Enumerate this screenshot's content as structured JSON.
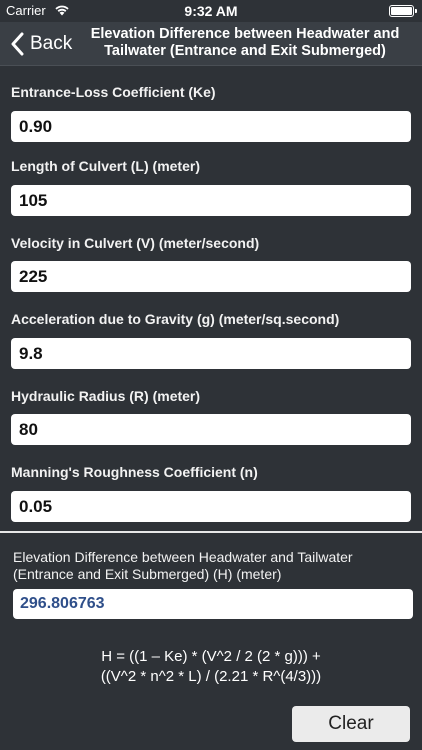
{
  "status_bar": {
    "carrier": "Carrier",
    "time": "9:32 AM"
  },
  "nav": {
    "back_label": "Back",
    "title_line1": "Elevation Difference between Headwater and",
    "title_line2": "Tailwater (Entrance and Exit Submerged)"
  },
  "fields": [
    {
      "label": "Entrance-Loss Coefficient (Ke)",
      "value": "0.90"
    },
    {
      "label": "Length of Culvert (L) (meter)",
      "value": "105"
    },
    {
      "label": "Velocity in Culvert (V) (meter/second)",
      "value": "225"
    },
    {
      "label": "Acceleration due to Gravity (g) (meter/sq.second)",
      "value": "9.8"
    },
    {
      "label": "Hydraulic Radius (R) (meter)",
      "value": "80"
    },
    {
      "label": "Manning's Roughness Coefficient (n)",
      "value": "0.05"
    }
  ],
  "result": {
    "label_line1": "Elevation Difference between Headwater and Tailwater",
    "label_line2": "(Entrance and Exit Submerged) (H) (meter)",
    "value": "296.806763"
  },
  "formula": {
    "line1": "H = ((1 – Ke) * (V^2 / 2 (2 * g))) +",
    "line2": "((V^2 * n^2 * L) / (2.21 * R^(4/3)))"
  },
  "clear_label": "Clear"
}
